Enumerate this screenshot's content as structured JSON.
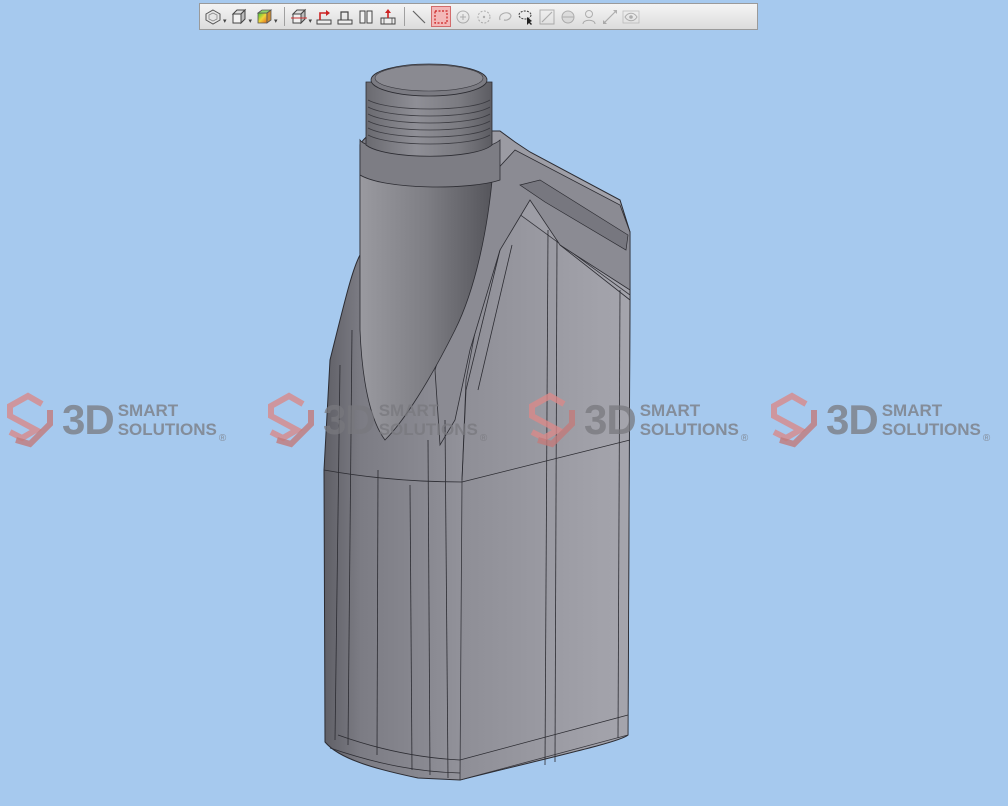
{
  "viewport": {
    "background": "#a6c9ee",
    "model": "bottle-3d-model"
  },
  "toolbar": {
    "buttons": [
      {
        "name": "view-orientation-button",
        "icon": "hexagon-view-icon",
        "dropdown": true
      },
      {
        "name": "display-style-button",
        "icon": "cube-icon",
        "dropdown": true
      },
      {
        "name": "appearance-button",
        "icon": "color-cube-icon",
        "dropdown": true
      },
      {
        "name": "section-view-button",
        "icon": "section-cube-icon",
        "dropdown": true
      },
      {
        "name": "previous-view-button",
        "icon": "arrow-plane-icon",
        "dropdown": false
      },
      {
        "name": "normal-to-button",
        "icon": "plane-icon",
        "dropdown": false
      },
      {
        "name": "split-view-button",
        "icon": "split-panels-icon",
        "dropdown": false
      },
      {
        "name": "zoom-to-fit-button",
        "icon": "house-arrow-icon",
        "dropdown": false
      },
      {
        "name": "line-select-button",
        "icon": "diagonal-line-icon",
        "dropdown": false
      },
      {
        "name": "box-select-button",
        "icon": "dashed-rectangle-icon",
        "dropdown": false,
        "active": true
      },
      {
        "name": "circle-select-button",
        "icon": "circle-plus-icon",
        "dropdown": false,
        "disabled": true
      },
      {
        "name": "circle-select-alt-button",
        "icon": "dashed-circle-icon",
        "dropdown": false,
        "disabled": true
      },
      {
        "name": "lasso-button",
        "icon": "loop-icon",
        "dropdown": false,
        "disabled": true
      },
      {
        "name": "lasso-select-button",
        "icon": "lasso-cursor-icon",
        "dropdown": false
      },
      {
        "name": "measure-button",
        "icon": "ruler-icon",
        "dropdown": false,
        "disabled": true
      },
      {
        "name": "shade-button",
        "icon": "sphere-icon",
        "dropdown": false,
        "disabled": true
      },
      {
        "name": "person-view-button",
        "icon": "person-icon",
        "dropdown": false,
        "disabled": true
      },
      {
        "name": "move-button",
        "icon": "move-arrows-icon",
        "dropdown": false,
        "disabled": true
      },
      {
        "name": "visibility-button",
        "icon": "eye-icon",
        "dropdown": false,
        "disabled": true
      }
    ]
  },
  "watermark": {
    "mark": "3D",
    "line1": "SMART",
    "line2": "SOLUTIONS",
    "registered": "®",
    "logo_color": "#d88a8a",
    "text_color": "#78787d",
    "instances": [
      "wm-1",
      "wm-2",
      "wm-3",
      "wm-4"
    ]
  }
}
